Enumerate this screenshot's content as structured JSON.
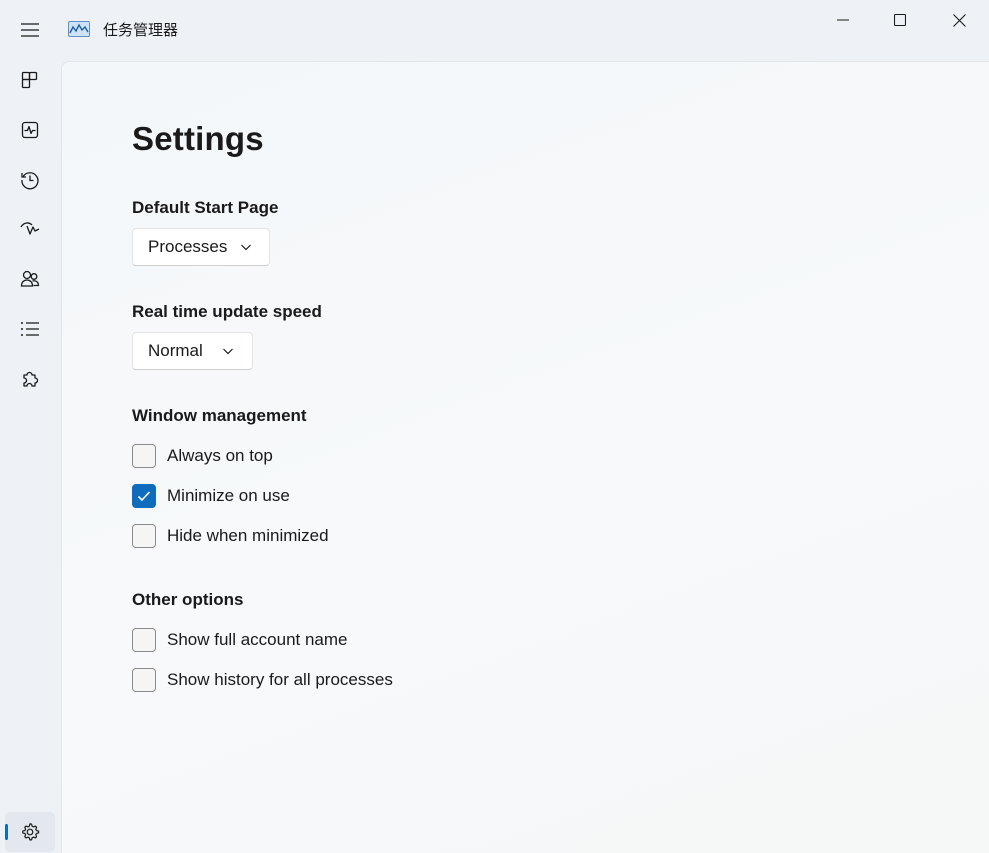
{
  "window": {
    "title": "任务管理器",
    "controls": {
      "minimize_icon": "minimize-icon",
      "maximize_icon": "maximize-icon",
      "close_icon": "close-icon"
    }
  },
  "nav": {
    "menu_icon": "hamburger-menu-icon",
    "items": [
      {
        "id": "processes",
        "icon": "processes-icon"
      },
      {
        "id": "performance",
        "icon": "performance-icon"
      },
      {
        "id": "app-history",
        "icon": "history-icon"
      },
      {
        "id": "startup-apps",
        "icon": "startup-icon"
      },
      {
        "id": "users",
        "icon": "users-icon"
      },
      {
        "id": "details",
        "icon": "details-list-icon"
      },
      {
        "id": "services",
        "icon": "services-puzzle-icon"
      }
    ],
    "settings": {
      "id": "settings",
      "icon": "gear-icon",
      "selected": true
    }
  },
  "settings": {
    "title": "Settings",
    "default_start_page": {
      "label": "Default Start Page",
      "value": "Processes"
    },
    "update_speed": {
      "label": "Real time update speed",
      "value": "Normal"
    },
    "window_management": {
      "label": "Window management",
      "options": [
        {
          "label": "Always on top",
          "checked": false
        },
        {
          "label": "Minimize on use",
          "checked": true
        },
        {
          "label": "Hide when minimized",
          "checked": false
        }
      ]
    },
    "other_options": {
      "label": "Other options",
      "options": [
        {
          "label": "Show full account name",
          "checked": false
        },
        {
          "label": "Show history for all processes",
          "checked": false
        }
      ]
    }
  },
  "colors": {
    "accent": "#0f6cbd",
    "window_bg": "#eef2f6",
    "content_bg": "#f6f8f9"
  }
}
